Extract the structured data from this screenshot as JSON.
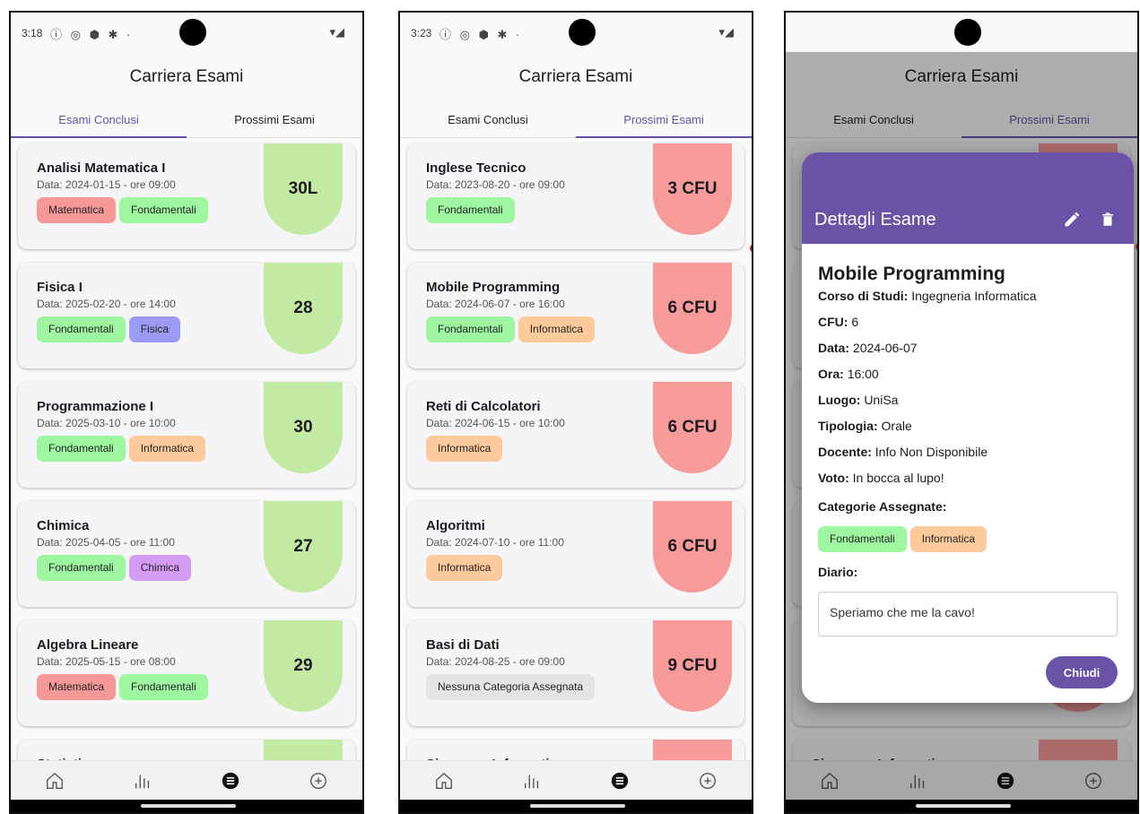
{
  "app_title": "Carriera Esami",
  "tabs": {
    "done": "Esami Conclusi",
    "next": "Prossimi Esami"
  },
  "colors": {
    "accent": "#6750a4",
    "grade_badge": "#c2eaa2",
    "cfu_badge": "#f79a9a"
  },
  "screen1": {
    "status_time": "3:18",
    "exams": [
      {
        "title": "Analisi Matematica I",
        "date": "Data: 2024-01-15 - ore 09:00",
        "badge": "30L",
        "chips": [
          {
            "label": "Matematica",
            "color": "red"
          },
          {
            "label": "Fondamentali",
            "color": "green"
          }
        ]
      },
      {
        "title": "Fisica I",
        "date": "Data: 2025-02-20 - ore 14:00",
        "badge": "28",
        "chips": [
          {
            "label": "Fondamentali",
            "color": "green"
          },
          {
            "label": "Fisica",
            "color": "blue"
          }
        ]
      },
      {
        "title": "Programmazione I",
        "date": "Data: 2025-03-10 - ore 10:00",
        "badge": "30",
        "chips": [
          {
            "label": "Fondamentali",
            "color": "green"
          },
          {
            "label": "Informatica",
            "color": "orange"
          }
        ]
      },
      {
        "title": "Chimica",
        "date": "Data: 2025-04-05 - ore 11:00",
        "badge": "27",
        "chips": [
          {
            "label": "Fondamentali",
            "color": "green"
          },
          {
            "label": "Chimica",
            "color": "purple"
          }
        ]
      },
      {
        "title": "Algebra Lineare",
        "date": "Data: 2025-05-15 - ore 08:00",
        "badge": "29",
        "chips": [
          {
            "label": "Matematica",
            "color": "red"
          },
          {
            "label": "Fondamentali",
            "color": "green"
          }
        ]
      },
      {
        "title": "Statistica",
        "date": "",
        "badge": "",
        "chips": []
      }
    ]
  },
  "screen2": {
    "status_time": "3:23",
    "exams": [
      {
        "title": "Inglese Tecnico",
        "date": "Data: 2023-08-20 - ore 09:00",
        "badge": "3 CFU",
        "chips": [
          {
            "label": "Fondamentali",
            "color": "green"
          }
        ]
      },
      {
        "title": "Mobile Programming",
        "date": "Data: 2024-06-07 - ore 16:00",
        "badge": "6 CFU",
        "chips": [
          {
            "label": "Fondamentali",
            "color": "green"
          },
          {
            "label": "Informatica",
            "color": "orange"
          }
        ]
      },
      {
        "title": "Reti di Calcolatori",
        "date": "Data: 2024-06-15 - ore 10:00",
        "badge": "6 CFU",
        "chips": [
          {
            "label": "Informatica",
            "color": "orange"
          }
        ]
      },
      {
        "title": "Algoritmi",
        "date": "Data: 2024-07-10 - ore 11:00",
        "badge": "6 CFU",
        "chips": [
          {
            "label": "Informatica",
            "color": "orange"
          }
        ]
      },
      {
        "title": "Basi di Dati",
        "date": "Data: 2024-08-25 - ore 09:00",
        "badge": "9 CFU",
        "chips": [
          {
            "label": "Nessuna Categoria Assegnata",
            "color": "gray"
          }
        ]
      },
      {
        "title": "Sicurezza Informatica",
        "date": "",
        "badge": "",
        "chips": []
      }
    ]
  },
  "dialog": {
    "header": "Dettagli Esame",
    "exam_name": "Mobile Programming",
    "fields": [
      {
        "label": "Corso di Studi:",
        "value": "Ingegneria Informatica"
      },
      {
        "label": "CFU:",
        "value": "6"
      },
      {
        "label": "Data:",
        "value": "2024-06-07"
      },
      {
        "label": "Ora:",
        "value": "16:00"
      },
      {
        "label": "Luogo:",
        "value": "UniSa"
      },
      {
        "label": "Tipologia:",
        "value": "Orale"
      },
      {
        "label": "Docente:",
        "value": "Info Non Disponibile"
      },
      {
        "label": "Voto:",
        "value": "In bocca al lupo!"
      }
    ],
    "categories_label": "Categorie Assegnate:",
    "categories": [
      {
        "label": "Fondamentali",
        "color": "green"
      },
      {
        "label": "Informatica",
        "color": "orange"
      }
    ],
    "diary_label": "Diario:",
    "diary_text": "Speriamo che me la cavo!",
    "close_label": "Chiudi",
    "background_card_title": "Sicurezza Informatica"
  },
  "icons": {
    "home": "home-icon",
    "stats": "bar-chart-icon",
    "list": "list-icon",
    "add": "add-circle-icon",
    "edit": "pencil-icon",
    "delete": "trash-icon"
  }
}
